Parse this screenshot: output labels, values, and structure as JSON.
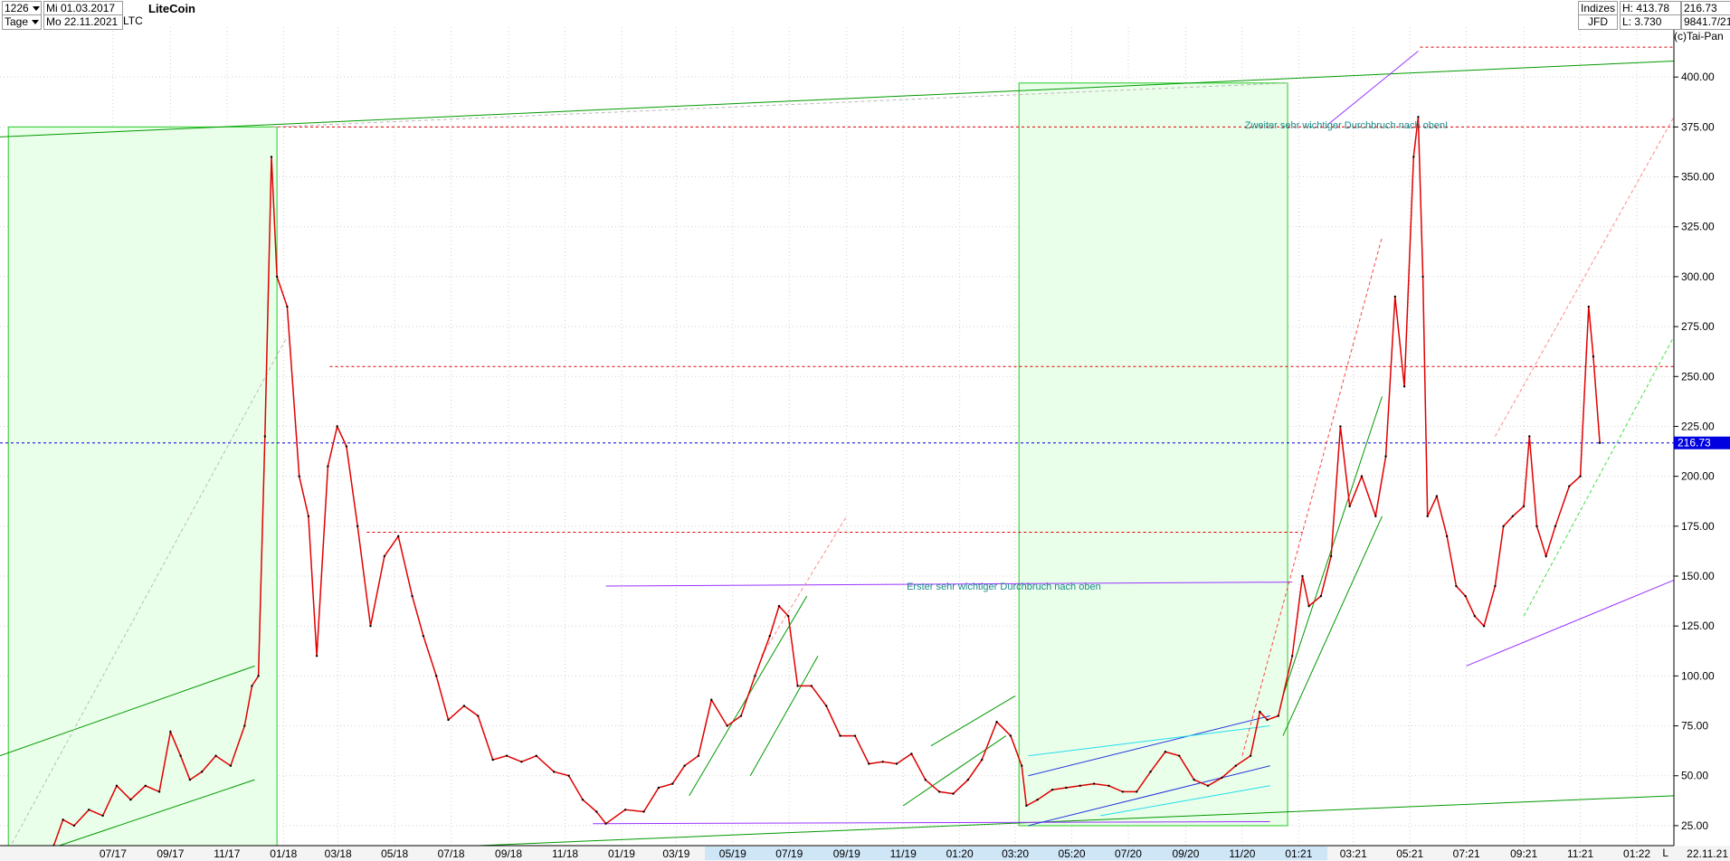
{
  "header": {
    "count": "1226",
    "period": "Tage",
    "date_from": "Mi 01.03.2017",
    "date_to": "Mo 22.11.2021",
    "title": "LiteCoin",
    "symbol": "LTC",
    "category": "Indizes",
    "source": "JFD",
    "high": "H: 413.78",
    "low": "L: 3.730",
    "last": "216.73",
    "range": "9841.7/21",
    "copyright": "(c)Tai-Pan"
  },
  "axis_corner": {
    "label": "L",
    "date": "22.11.21"
  },
  "price_marker": "216.73",
  "annotations": [
    {
      "text": "Zweiter sehr wichtiger Durchbruch nach oben!",
      "x": "2021-03-01",
      "y": 376
    },
    {
      "text": "Erster sehr wichtiger Durchbruch nach oben",
      "x": "2020-03-01",
      "y": 145
    }
  ],
  "chart_data": {
    "type": "line",
    "title": "LiteCoin",
    "xlabel": "",
    "ylabel": "",
    "ylim": [
      15,
      425
    ],
    "xlim": [
      "2017-03-01",
      "2022-02-10"
    ],
    "x_ticks": [
      "07/17",
      "09/17",
      "11/17",
      "01/18",
      "03/18",
      "05/18",
      "07/18",
      "09/18",
      "11/18",
      "01/19",
      "03/19",
      "05/19",
      "07/19",
      "09/19",
      "11/19",
      "01:20",
      "03:20",
      "05:20",
      "07/20",
      "09/20",
      "11/20",
      "01:21",
      "03:21",
      "05:21",
      "07:21",
      "09:21",
      "11:21",
      "01:22"
    ],
    "y_ticks": [
      "25.00",
      "50.00",
      "75.00",
      "100.00",
      "125.00",
      "150.00",
      "175.00",
      "200.00",
      "225.00",
      "250.00",
      "275.00",
      "300.00",
      "325.00",
      "350.00",
      "375.00",
      "400.00"
    ],
    "grid": true,
    "series": [
      {
        "color": "#e00000",
        "points": [
          [
            "2017-03-01",
            4
          ],
          [
            "2017-03-20",
            5
          ],
          [
            "2017-04-10",
            10
          ],
          [
            "2017-04-28",
            15
          ],
          [
            "2017-05-08",
            28
          ],
          [
            "2017-05-20",
            25
          ],
          [
            "2017-06-05",
            33
          ],
          [
            "2017-06-20",
            30
          ],
          [
            "2017-07-05",
            45
          ],
          [
            "2017-07-20",
            38
          ],
          [
            "2017-08-05",
            45
          ],
          [
            "2017-08-20",
            42
          ],
          [
            "2017-09-01",
            72
          ],
          [
            "2017-09-12",
            60
          ],
          [
            "2017-09-22",
            48
          ],
          [
            "2017-10-05",
            52
          ],
          [
            "2017-10-20",
            60
          ],
          [
            "2017-11-05",
            55
          ],
          [
            "2017-11-20",
            75
          ],
          [
            "2017-11-28",
            95
          ],
          [
            "2017-12-05",
            100
          ],
          [
            "2017-12-12",
            220
          ],
          [
            "2017-12-19",
            360
          ],
          [
            "2017-12-25",
            300
          ],
          [
            "2018-01-05",
            285
          ],
          [
            "2018-01-18",
            200
          ],
          [
            "2018-01-28",
            180
          ],
          [
            "2018-02-06",
            110
          ],
          [
            "2018-02-18",
            205
          ],
          [
            "2018-02-28",
            225
          ],
          [
            "2018-03-10",
            215
          ],
          [
            "2018-03-22",
            175
          ],
          [
            "2018-04-05",
            125
          ],
          [
            "2018-04-20",
            160
          ],
          [
            "2018-05-05",
            170
          ],
          [
            "2018-05-20",
            140
          ],
          [
            "2018-06-01",
            120
          ],
          [
            "2018-06-15",
            100
          ],
          [
            "2018-06-28",
            78
          ],
          [
            "2018-07-15",
            85
          ],
          [
            "2018-07-30",
            80
          ],
          [
            "2018-08-15",
            58
          ],
          [
            "2018-08-30",
            60
          ],
          [
            "2018-09-15",
            57
          ],
          [
            "2018-10-01",
            60
          ],
          [
            "2018-10-20",
            52
          ],
          [
            "2018-11-05",
            50
          ],
          [
            "2018-11-20",
            38
          ],
          [
            "2018-12-05",
            32
          ],
          [
            "2018-12-15",
            26
          ],
          [
            "2019-01-05",
            33
          ],
          [
            "2019-01-25",
            32
          ],
          [
            "2019-02-10",
            44
          ],
          [
            "2019-02-25",
            46
          ],
          [
            "2019-03-10",
            55
          ],
          [
            "2019-03-25",
            60
          ],
          [
            "2019-04-08",
            88
          ],
          [
            "2019-04-25",
            75
          ],
          [
            "2019-05-10",
            80
          ],
          [
            "2019-05-25",
            100
          ],
          [
            "2019-06-10",
            120
          ],
          [
            "2019-06-20",
            135
          ],
          [
            "2019-06-30",
            130
          ],
          [
            "2019-07-10",
            95
          ],
          [
            "2019-07-25",
            95
          ],
          [
            "2019-08-10",
            85
          ],
          [
            "2019-08-25",
            70
          ],
          [
            "2019-09-10",
            70
          ],
          [
            "2019-09-25",
            56
          ],
          [
            "2019-10-10",
            57
          ],
          [
            "2019-10-25",
            56
          ],
          [
            "2019-11-10",
            61
          ],
          [
            "2019-11-25",
            48
          ],
          [
            "2019-12-10",
            42
          ],
          [
            "2019-12-25",
            41
          ],
          [
            "2020-01-10",
            48
          ],
          [
            "2020-01-25",
            58
          ],
          [
            "2020-02-10",
            77
          ],
          [
            "2020-02-25",
            70
          ],
          [
            "2020-03-08",
            55
          ],
          [
            "2020-03-13",
            35
          ],
          [
            "2020-03-25",
            38
          ],
          [
            "2020-04-10",
            43
          ],
          [
            "2020-04-25",
            44
          ],
          [
            "2020-05-10",
            45
          ],
          [
            "2020-05-25",
            46
          ],
          [
            "2020-06-10",
            45
          ],
          [
            "2020-06-25",
            42
          ],
          [
            "2020-07-10",
            42
          ],
          [
            "2020-07-25",
            52
          ],
          [
            "2020-08-10",
            62
          ],
          [
            "2020-08-25",
            60
          ],
          [
            "2020-09-10",
            48
          ],
          [
            "2020-09-25",
            45
          ],
          [
            "2020-10-10",
            49
          ],
          [
            "2020-10-25",
            55
          ],
          [
            "2020-11-10",
            60
          ],
          [
            "2020-11-20",
            82
          ],
          [
            "2020-11-28",
            78
          ],
          [
            "2020-12-10",
            80
          ],
          [
            "2020-12-25",
            110
          ],
          [
            "2021-01-05",
            150
          ],
          [
            "2021-01-12",
            135
          ],
          [
            "2021-01-25",
            140
          ],
          [
            "2021-02-05",
            160
          ],
          [
            "2021-02-15",
            225
          ],
          [
            "2021-02-25",
            185
          ],
          [
            "2021-03-10",
            200
          ],
          [
            "2021-03-25",
            180
          ],
          [
            "2021-04-05",
            210
          ],
          [
            "2021-04-15",
            290
          ],
          [
            "2021-04-25",
            245
          ],
          [
            "2021-05-05",
            360
          ],
          [
            "2021-05-10",
            380
          ],
          [
            "2021-05-15",
            300
          ],
          [
            "2021-05-20",
            180
          ],
          [
            "2021-05-30",
            190
          ],
          [
            "2021-06-10",
            170
          ],
          [
            "2021-06-20",
            145
          ],
          [
            "2021-06-30",
            140
          ],
          [
            "2021-07-10",
            130
          ],
          [
            "2021-07-20",
            125
          ],
          [
            "2021-08-01",
            145
          ],
          [
            "2021-08-10",
            175
          ],
          [
            "2021-08-20",
            180
          ],
          [
            "2021-09-01",
            185
          ],
          [
            "2021-09-07",
            220
          ],
          [
            "2021-09-15",
            175
          ],
          [
            "2021-09-25",
            160
          ],
          [
            "2021-10-05",
            175
          ],
          [
            "2021-10-20",
            195
          ],
          [
            "2021-11-01",
            200
          ],
          [
            "2021-11-10",
            285
          ],
          [
            "2021-11-15",
            260
          ],
          [
            "2021-11-22",
            216.73
          ]
        ]
      }
    ],
    "horizontal_levels": [
      {
        "y": 375,
        "color": "#e00000",
        "style": "dotted"
      },
      {
        "y": 255,
        "color": "#e00000",
        "style": "dotted"
      },
      {
        "y": 172,
        "color": "#e00000",
        "style": "dotted"
      },
      {
        "y": 216.73,
        "color": "#0000e0",
        "style": "dotted"
      },
      {
        "y": 415,
        "color": "#e00000",
        "style": "dotted"
      }
    ]
  },
  "colors": {
    "price_line": "#e00000",
    "grid": "#d0d0d0",
    "box_fill": "#eaffea",
    "box_stroke": "#22cc22",
    "trend_green": "#009900",
    "trend_purple": "#9933ff",
    "trend_blue": "#2233dd",
    "trend_cyan": "#22ddee",
    "annotation": "#1a8a8a",
    "marker_bg": "#0000e0"
  }
}
